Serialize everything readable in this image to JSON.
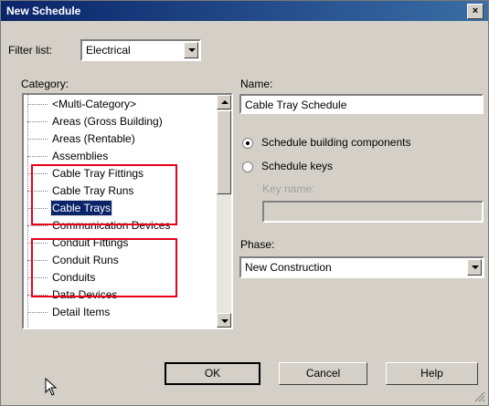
{
  "window": {
    "title": "New Schedule",
    "close_glyph": "×"
  },
  "filter": {
    "label": "Filter list:",
    "value": "Electrical"
  },
  "category": {
    "label": "Category:",
    "items": [
      {
        "label": "<Multi-Category>",
        "selected": false
      },
      {
        "label": "Areas (Gross Building)",
        "selected": false
      },
      {
        "label": "Areas (Rentable)",
        "selected": false
      },
      {
        "label": "Assemblies",
        "selected": false
      },
      {
        "label": "Cable Tray Fittings",
        "selected": false
      },
      {
        "label": "Cable Tray Runs",
        "selected": false
      },
      {
        "label": "Cable Trays",
        "selected": true
      },
      {
        "label": "Communication Devices",
        "selected": false
      },
      {
        "label": "Conduit Fittings",
        "selected": false
      },
      {
        "label": "Conduit Runs",
        "selected": false
      },
      {
        "label": "Conduits",
        "selected": false
      },
      {
        "label": "Data Devices",
        "selected": false
      },
      {
        "label": "Detail Items",
        "selected": false
      }
    ]
  },
  "name": {
    "label": "Name:",
    "value": "Cable Tray Schedule"
  },
  "options": {
    "schedule_components": "Schedule building components",
    "schedule_keys": "Schedule keys",
    "selected": "schedule_components"
  },
  "key_name": {
    "label": "Key name:",
    "value": ""
  },
  "phase": {
    "label": "Phase:",
    "value": "New Construction"
  },
  "buttons": {
    "ok": "OK",
    "cancel": "Cancel",
    "help": "Help"
  },
  "colors": {
    "highlight": "#e8001c",
    "selection": "#0a246a",
    "dialog_bg": "#d4d0c8"
  }
}
